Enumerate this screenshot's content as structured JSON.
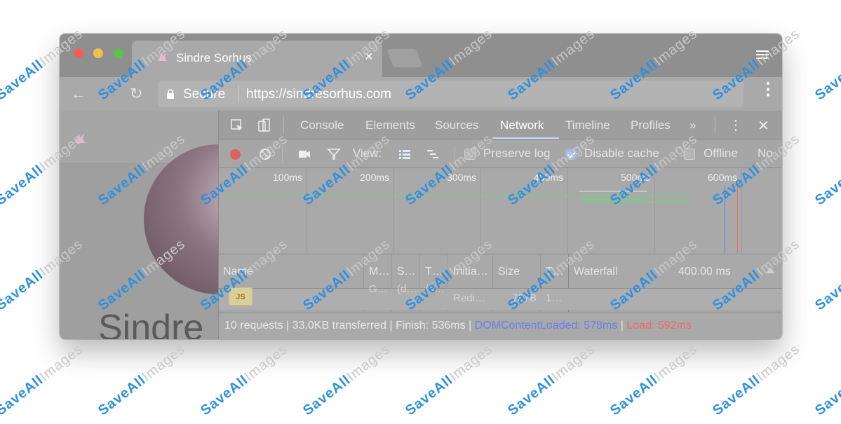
{
  "browser": {
    "tab_title": "Sindre Sorhus",
    "tab_close": "×",
    "secure_label": "Secure",
    "url": "https://sindresorhus.com",
    "back": "←",
    "reload": "↻",
    "star": "☆",
    "menu": "⋮"
  },
  "page": {
    "name_fragment": "Sindre"
  },
  "devtools": {
    "tabs": [
      {
        "label": "Console"
      },
      {
        "label": "Elements"
      },
      {
        "label": "Sources"
      },
      {
        "label": "Network"
      },
      {
        "label": "Timeline"
      },
      {
        "label": "Profiles"
      }
    ],
    "active_tab": "Network",
    "overflow": "»",
    "more": "⋮",
    "close": "✕",
    "controls": {
      "view_label": "View:",
      "preserve_log": "Preserve log",
      "disable_cache": "Disable cache",
      "offline": "Offline",
      "throttle_fragment": "No",
      "disable_cache_checked": true
    },
    "overview_ticks": [
      "100ms",
      "200ms",
      "300ms",
      "400ms",
      "500ms",
      "600ms"
    ],
    "columns": [
      "Name",
      "M…",
      "S…",
      "T…",
      "Initia…",
      "Size",
      "T…",
      "Waterfall",
      "400.00 ms"
    ],
    "row": {
      "type_icon": "JS",
      "method": "G…",
      "status": "(d…",
      "type": "(s…",
      "initiator": "Redi…",
      "size": "757B",
      "time": "1…"
    },
    "status": {
      "summary": "10 requests | 33.0KB transferred | Finish: 536ms |",
      "dom_content_loaded": "DOMContentLoaded: 578ms",
      "divider": "|",
      "load": "Load: 592ms"
    }
  },
  "colors": {
    "dcl": "#6a7fe8",
    "load": "#ee6a6a",
    "watermark": "#2f8fe0"
  },
  "watermark": {
    "brand": "SaveAll",
    "suffix": "Images"
  }
}
